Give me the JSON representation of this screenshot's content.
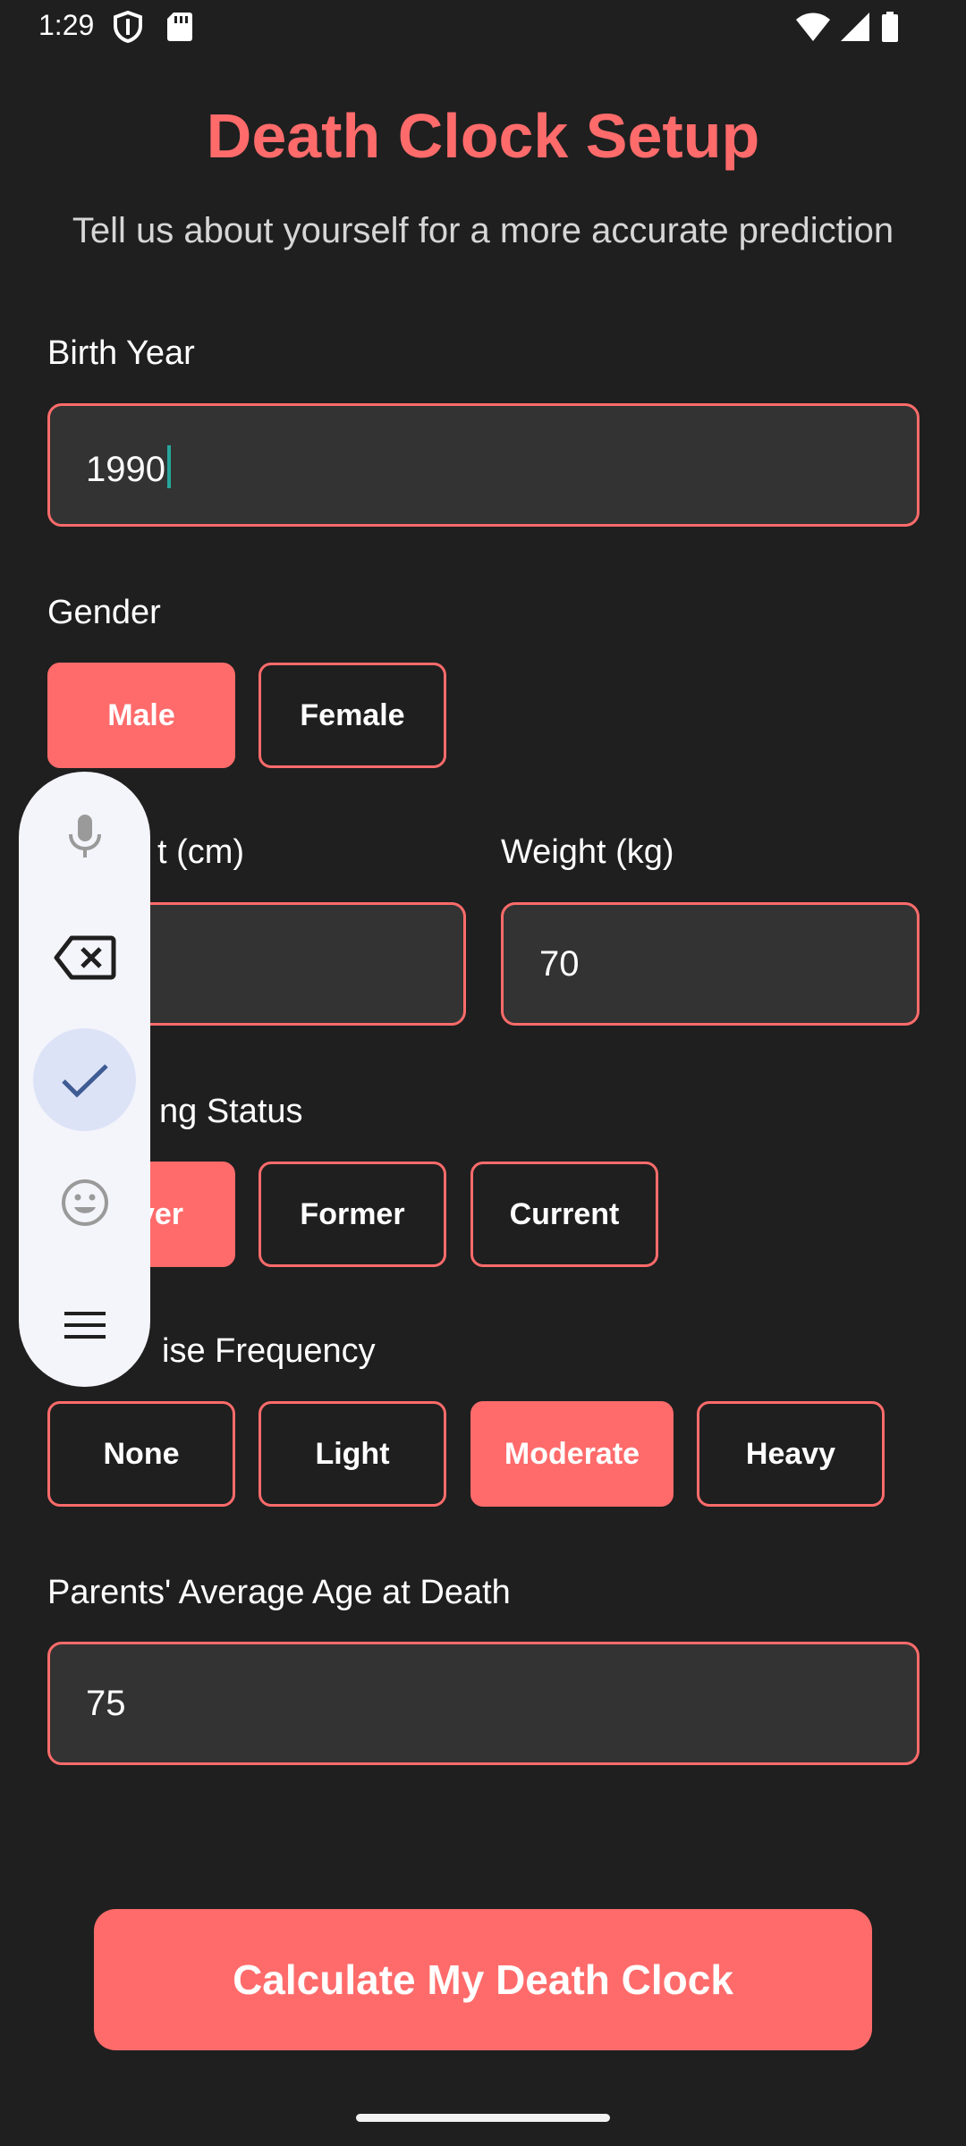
{
  "status_bar": {
    "time": "1:29",
    "icons": [
      "shield-icon",
      "sd-card-icon",
      "wifi-icon",
      "signal-icon",
      "battery-icon"
    ]
  },
  "header": {
    "title": "Death Clock Setup",
    "subtitle": "Tell us about yourself for a more accurate prediction"
  },
  "form": {
    "birth_year": {
      "label": "Birth Year",
      "value": "1990"
    },
    "gender": {
      "label": "Gender",
      "options": [
        "Male",
        "Female"
      ],
      "selected": "Male"
    },
    "height": {
      "label": "t (cm)"
    },
    "weight": {
      "label": "Weight (kg)",
      "value": "70"
    },
    "smoking": {
      "label": "ng Status",
      "options": [
        "ver",
        "Former",
        "Current"
      ],
      "selected": "ver"
    },
    "exercise": {
      "label": "ise Frequency",
      "options": [
        "None",
        "Light",
        "Moderate",
        "Heavy"
      ],
      "selected": "Moderate"
    },
    "parents_age": {
      "label": "Parents' Average Age at Death",
      "value": "75"
    }
  },
  "cta": {
    "label": "Calculate My Death Clock"
  },
  "keyboard_toolbar": {
    "buttons": [
      "microphone-icon",
      "backspace-icon",
      "check-icon",
      "emoji-icon",
      "menu-icon"
    ],
    "active": "check-icon"
  },
  "colors": {
    "accent": "#ff6b6b",
    "background": "#1f1f1f",
    "field_bg": "#333333",
    "cursor": "#26a69a",
    "toolbar_bg": "#f4f4fb",
    "toolbar_active": "#dde3f7"
  }
}
